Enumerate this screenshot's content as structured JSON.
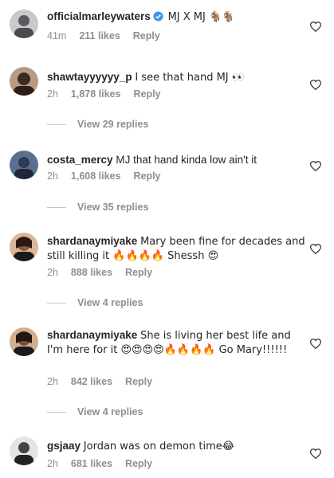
{
  "comments": [
    {
      "username": "officialmarleywaters",
      "verified": true,
      "text": "MJ X MJ 🐐🐐",
      "time": "41m",
      "likes": "211 likes",
      "reply": "Reply",
      "avatar_color": "#6b6b70"
    },
    {
      "username": "shawtayyyyyy_p",
      "text": "I see that hand MJ 👀",
      "time": "2h",
      "likes": "1,878 likes",
      "reply": "Reply",
      "view_replies": "View 29 replies",
      "avatar_color": "#3a2a22"
    },
    {
      "username": "costa_mercy",
      "text": "MJ that hand kinda low ain't it",
      "time": "2h",
      "likes": "1,608 likes",
      "reply": "Reply",
      "view_replies": "View 35 replies",
      "avatar_color": "#2f3b52"
    },
    {
      "username": "shardanaymiyake",
      "text": "Mary been fine for decades and still killing it 🔥🔥🔥🔥 Shessh 😍",
      "time": "2h",
      "likes": "888 likes",
      "reply": "Reply",
      "view_replies": "View 4 replies",
      "avatar_color": "#8a5a3c"
    },
    {
      "username": "shardanaymiyake",
      "text": "She is living her best life and I'm here for it 😍😍😍😍🔥🔥🔥🔥 Go Mary!!!!!!",
      "time": "2h",
      "likes": "842 likes",
      "reply": "Reply",
      "view_replies": "View 4 replies",
      "avatar_color": "#7a4e33"
    },
    {
      "username": "gsjaay",
      "text": "Jordan was on demon time😂",
      "time": "2h",
      "likes": "681 likes",
      "reply": "Reply",
      "avatar_color": "#9a9a9a"
    }
  ],
  "colors": {
    "text": "#262626",
    "secondary": "#8e8e8e",
    "verified_blue": "#3897f0",
    "divider": "#c7c7c7"
  },
  "icons": [
    "heart-icon",
    "verified-badge-icon"
  ]
}
